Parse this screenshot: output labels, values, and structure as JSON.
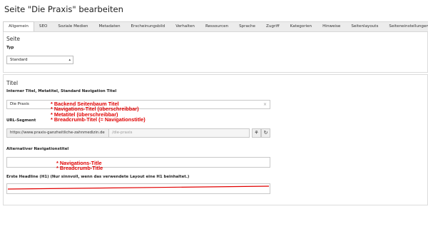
{
  "page": {
    "title": "Seite \"Die Praxis\" bearbeiten"
  },
  "tabs": [
    {
      "label": "Allgemein",
      "active": true
    },
    {
      "label": "SEO"
    },
    {
      "label": "Soziale Medien"
    },
    {
      "label": "Metadaten"
    },
    {
      "label": "Erscheinungsbild"
    },
    {
      "label": "Verhalten"
    },
    {
      "label": "Ressourcen"
    },
    {
      "label": "Sprache"
    },
    {
      "label": "Zugriff"
    },
    {
      "label": "Kategorien"
    },
    {
      "label": "Hinweise"
    },
    {
      "label": "Seitenlayouts"
    },
    {
      "label": "Seiteneinstellungen"
    }
  ],
  "seite": {
    "heading": "Seite",
    "typ_label": "Typ",
    "typ_value": "Standard",
    "caret_icon": "chevron-down-icon"
  },
  "titel": {
    "heading": "Titel",
    "internal_label": "Interner Titel, Metatitel, Standard Navigation Titel",
    "title_value": "Die Praxis",
    "clear_symbol": "×",
    "url_label": "URL-Segment",
    "url_prefix": "https://www.praxis-ganzheitliche-zahnmedizin.de",
    "url_slug_placeholder": "/die-praxis",
    "alt_nav_label": "Alternativer Navigationstitel",
    "alt_nav_value": "",
    "h1_label": "Erste Headline (H1) (Nur sinnvoll, wenn das verwendete Layout eine H1 beinhaltet.)",
    "h1_value": ""
  },
  "annotations": {
    "title_notes": [
      "* Backend Seitenbaum Titel",
      "* Navigations-Titel (überschreibbar)",
      "* Metatitel (überschreibbar)",
      "* Breadcrumb-Titel (= Navigationstitle)"
    ],
    "alt_notes": [
      "* Navigations-Title",
      "* Breadcrumb-Title"
    ],
    "color": "#e00000"
  }
}
